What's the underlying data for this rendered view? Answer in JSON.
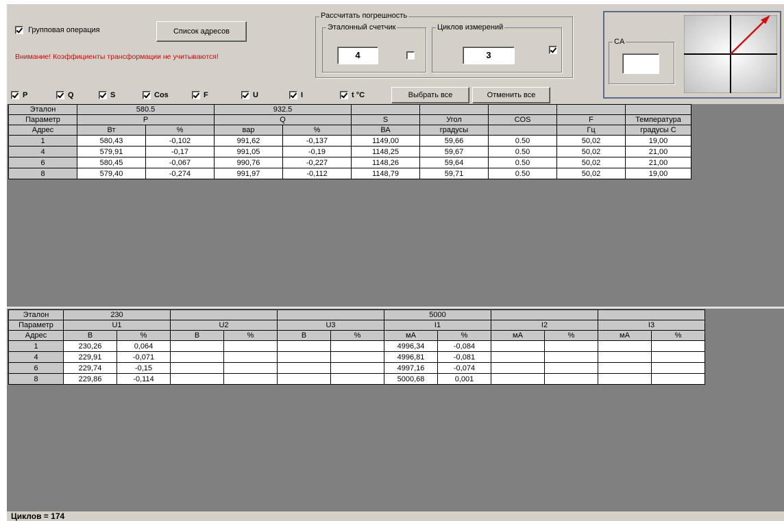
{
  "toolbar": {
    "group_operation_label": "Групповая операция",
    "group_operation_checked": true,
    "address_list_button": "Список адресов",
    "warning_text": "Внимание! Коэффициенты трансформации не учитываются!"
  },
  "error_calc": {
    "group_label": "Рассчитать погрешность",
    "reference_meter_label": "Эталонный счетчик",
    "reference_meter_value": "4",
    "reference_meter_checked": false,
    "cycles_label": "Циклов измерений",
    "cycles_value": "3",
    "cycles_checked": true
  },
  "ca": {
    "label": "CA",
    "value": ""
  },
  "filters": [
    {
      "label": "P",
      "checked": true
    },
    {
      "label": "Q",
      "checked": true
    },
    {
      "label": "S",
      "checked": true
    },
    {
      "label": "Cos",
      "checked": true
    },
    {
      "label": "F",
      "checked": true
    },
    {
      "label": "U",
      "checked": true
    },
    {
      "label": "I",
      "checked": true
    },
    {
      "label": "t °C",
      "checked": true
    }
  ],
  "buttons": {
    "select_all": "Выбрать все",
    "cancel_all": "Отменить все"
  },
  "power_table": {
    "row_labels": {
      "reference": "Эталон",
      "parameter": "Параметр",
      "address": "Адрес"
    },
    "reference": {
      "P": "580.5",
      "Q": "932.5"
    },
    "parameters": {
      "P": "P",
      "Q": "Q",
      "S": "S",
      "angle": "Угол",
      "cos": "COS",
      "F": "F",
      "temp": "Температура"
    },
    "units": {
      "P": "Вт",
      "P_pct": "%",
      "Q": "вар",
      "Q_pct": "%",
      "S": "ВА",
      "angle": "градусы",
      "cos": "",
      "F": "Гц",
      "temp": "градусы С"
    },
    "rows": [
      {
        "addr": "1",
        "p": "580,43",
        "p_pct": "-0,102",
        "q": "991,62",
        "q_pct": "-0,137",
        "s": "1149,00",
        "angle": "59,66",
        "cos": "0.50",
        "f": "50,02",
        "temp": "19,00"
      },
      {
        "addr": "4",
        "p": "579,91",
        "p_pct": "-0,17",
        "q": "991,05",
        "q_pct": "-0,19",
        "s": "1148,25",
        "angle": "59,67",
        "cos": "0.50",
        "f": "50,02",
        "temp": "21,00"
      },
      {
        "addr": "6",
        "p": "580,45",
        "p_pct": "-0,067",
        "q": "990,76",
        "q_pct": "-0,227",
        "s": "1148,26",
        "angle": "59,64",
        "cos": "0.50",
        "f": "50,02",
        "temp": "21,00"
      },
      {
        "addr": "8",
        "p": "579,40",
        "p_pct": "-0,274",
        "q": "991,97",
        "q_pct": "-0,112",
        "s": "1148,79",
        "angle": "59,71",
        "cos": "0.50",
        "f": "50,02",
        "temp": "19,00"
      }
    ]
  },
  "vi_table": {
    "row_labels": {
      "reference": "Эталон",
      "parameter": "Параметр",
      "address": "Адрес"
    },
    "reference": {
      "U1": "230",
      "I1": "5000"
    },
    "parameters": {
      "U1": "U1",
      "U2": "U2",
      "U3": "U3",
      "I1": "I1",
      "I2": "I2",
      "I3": "I3"
    },
    "units": {
      "V": "В",
      "pct": "%",
      "mA": "мА"
    },
    "rows": [
      {
        "addr": "1",
        "u1": "230,26",
        "u1_pct": "0,064",
        "i1": "4996,34",
        "i1_pct": "-0,084"
      },
      {
        "addr": "4",
        "u1": "229,91",
        "u1_pct": "-0,071",
        "i1": "4996,81",
        "i1_pct": "-0,081"
      },
      {
        "addr": "6",
        "u1": "229,74",
        "u1_pct": "-0,15",
        "i1": "4997,16",
        "i1_pct": "-0,074"
      },
      {
        "addr": "8",
        "u1": "229,86",
        "u1_pct": "-0,114",
        "i1": "5000,68",
        "i1_pct": "0,001"
      }
    ]
  },
  "status": {
    "cycles_text": "Циклов = 174"
  },
  "colors": {
    "warning": "#c01010",
    "panel": "#d4d0c8",
    "grid_background": "#808080",
    "vector_arrow": "#d01010"
  }
}
